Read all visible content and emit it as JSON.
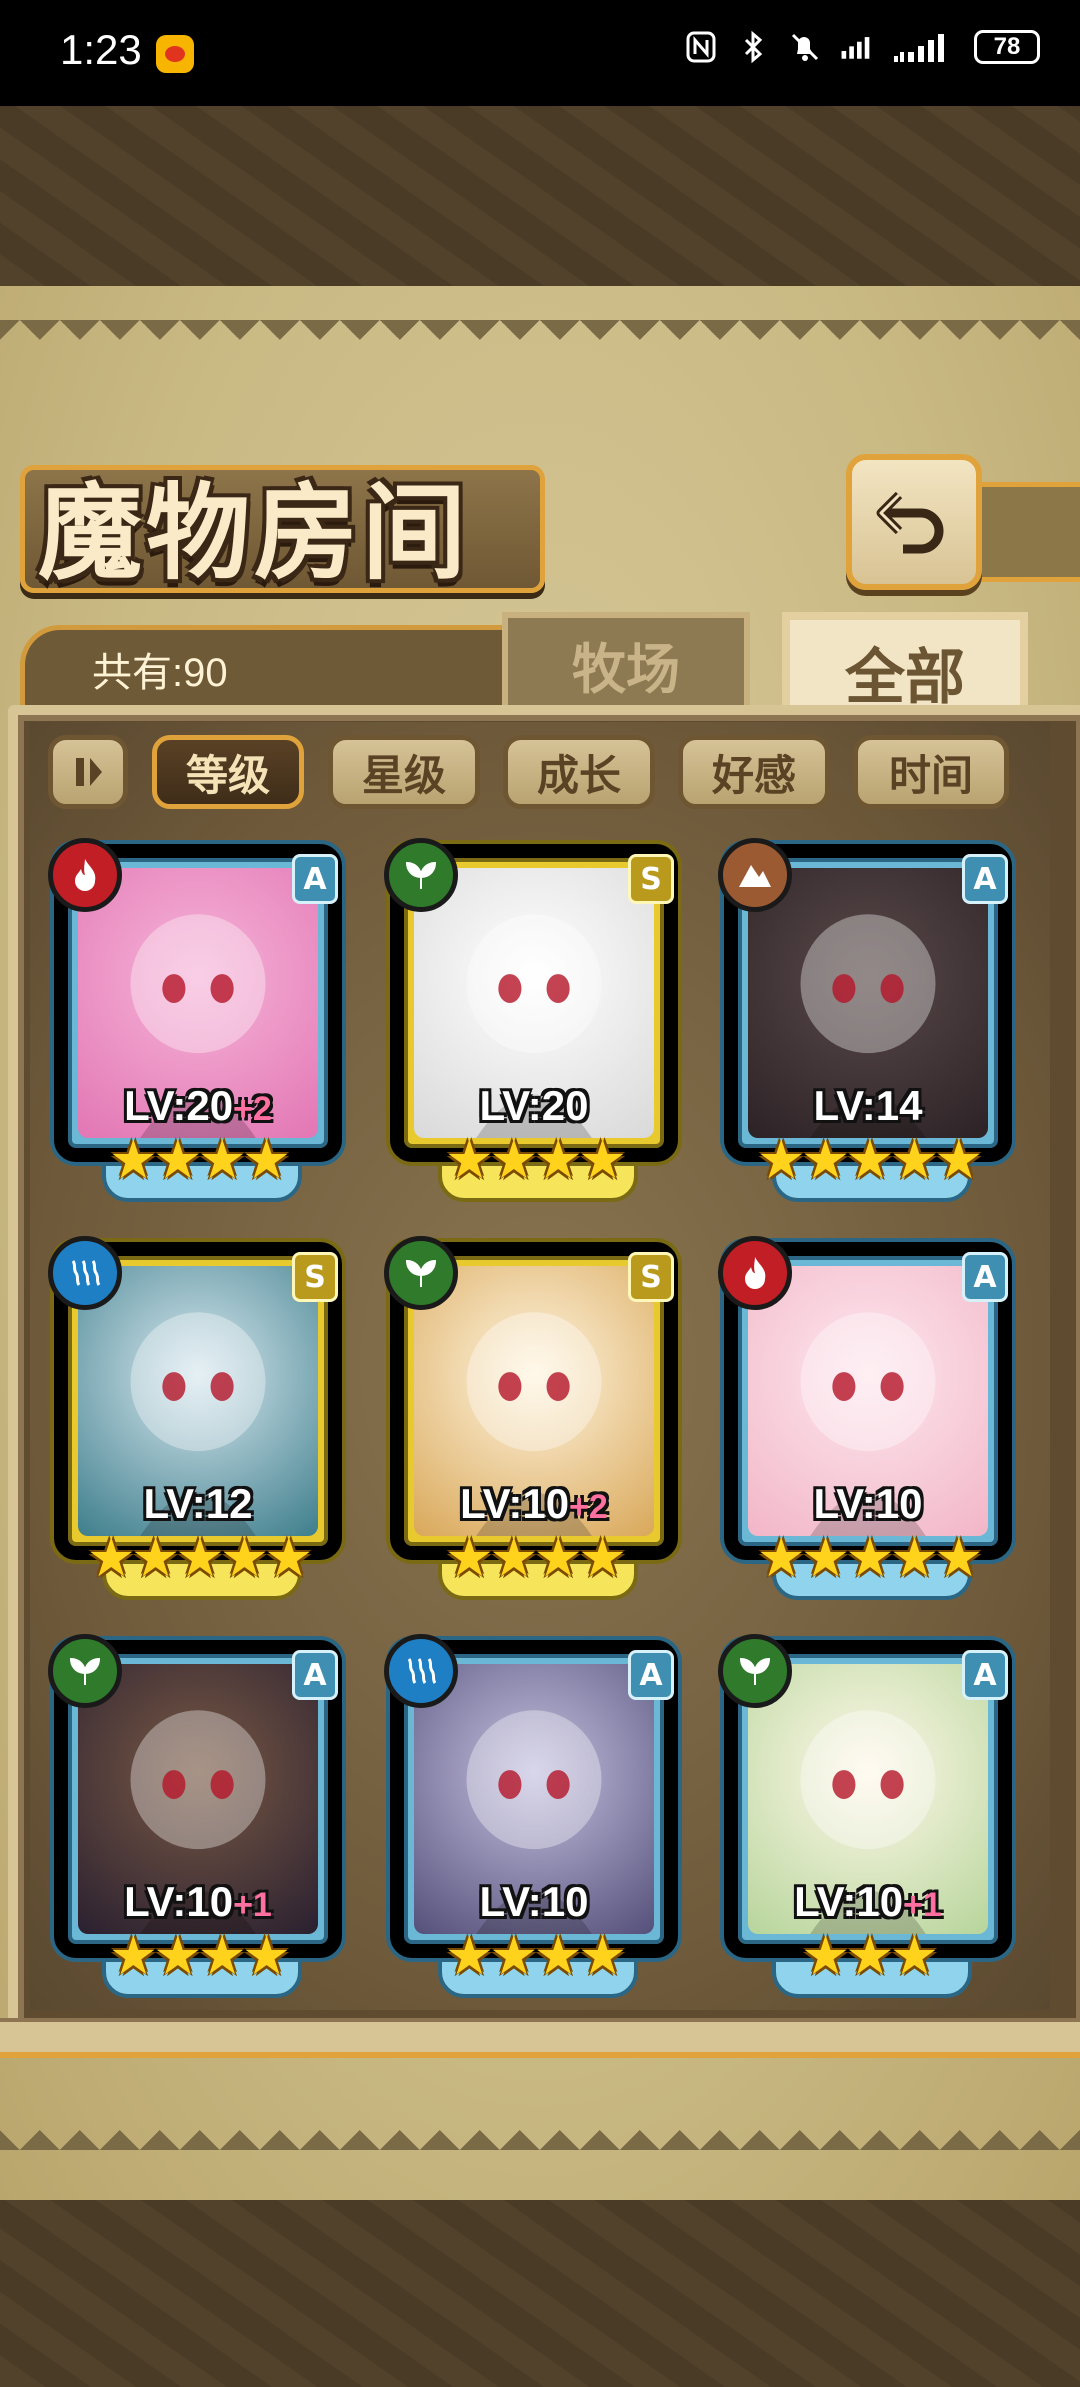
{
  "status_bar": {
    "time": "1:23",
    "icons": [
      "weibo-icon",
      "nfc-icon",
      "bluetooth-icon",
      "mute-icon",
      "signal-icon",
      "signal-4g-icon"
    ],
    "battery": "78"
  },
  "header": {
    "title": "魔物房间",
    "back_icon": "return-icon"
  },
  "tabs": {
    "count_label": "共有:90",
    "pasture": "牧场",
    "all": "全部",
    "active": "全部"
  },
  "sort": {
    "toggle_icon": "pause-icon",
    "options": [
      "等级",
      "星级",
      "成长",
      "好感",
      "时间"
    ],
    "active": "等级"
  },
  "monsters": [
    {
      "element": "fire",
      "rank": "A",
      "level": "LV:20",
      "bonus": "+2",
      "stars": 4,
      "stars_text": "★★★★"
    },
    {
      "element": "leaf",
      "rank": "S",
      "level": "LV:20",
      "bonus": "",
      "stars": 4,
      "stars_text": "★★★★"
    },
    {
      "element": "earth",
      "rank": "A",
      "level": "LV:14",
      "bonus": "",
      "stars": 5,
      "stars_text": "★★★★★"
    },
    {
      "element": "water",
      "rank": "S",
      "level": "LV:12",
      "bonus": "",
      "stars": 5,
      "stars_text": "★★★★★"
    },
    {
      "element": "leaf",
      "rank": "S",
      "level": "LV:10",
      "bonus": "+2",
      "stars": 4,
      "stars_text": "★★★★"
    },
    {
      "element": "fire",
      "rank": "A",
      "level": "LV:10",
      "bonus": "",
      "stars": 5,
      "stars_text": "★★★★★"
    },
    {
      "element": "leaf",
      "rank": "A",
      "level": "LV:10",
      "bonus": "+1",
      "stars": 4,
      "stars_text": "★★★★"
    },
    {
      "element": "water",
      "rank": "A",
      "level": "LV:10",
      "bonus": "",
      "stars": 4,
      "stars_text": "★★★★"
    },
    {
      "element": "leaf",
      "rank": "A",
      "level": "LV:10",
      "bonus": "+1",
      "stars": 3,
      "stars_text": "★★★"
    }
  ],
  "colors": {
    "frame_a": "#8fd4ec",
    "frame_s": "#f6e45a",
    "accent_gold": "#e0a23a",
    "parchment": "#d7c99b"
  }
}
